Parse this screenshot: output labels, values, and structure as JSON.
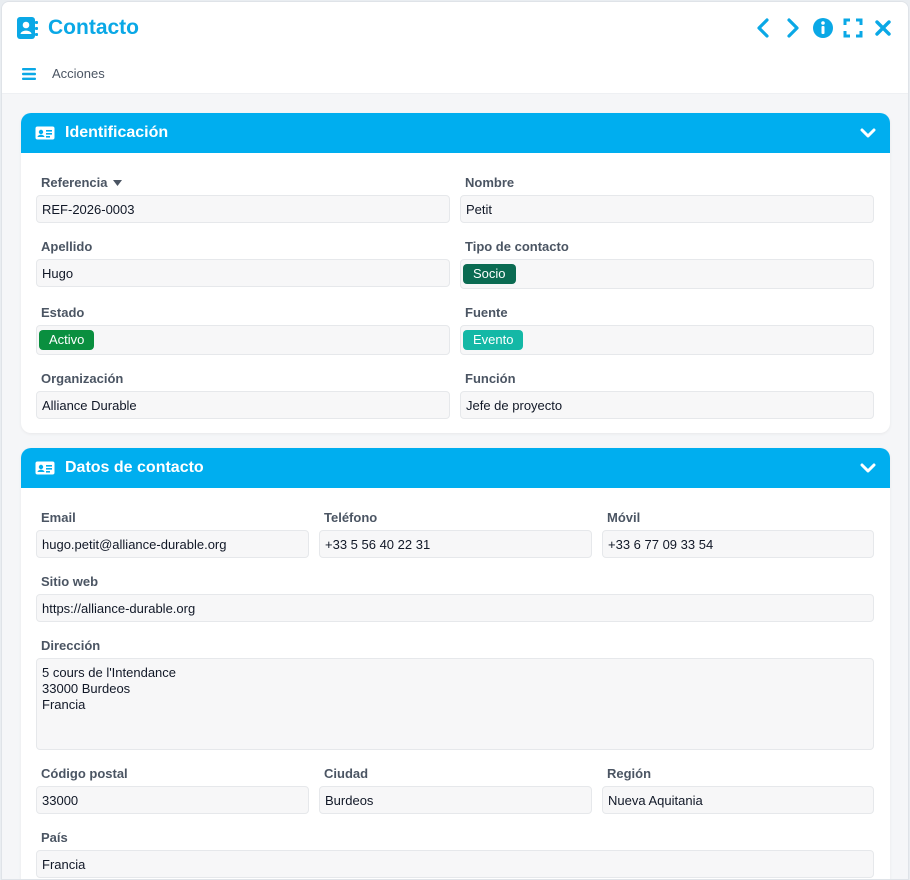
{
  "window": {
    "title": "Contacto",
    "accent": "#00aeef",
    "icons": [
      "contact-book-icon",
      "prev-icon",
      "next-icon",
      "info-icon",
      "fullscreen-icon",
      "close-icon"
    ]
  },
  "toolbar": {
    "actions_label": "Acciones"
  },
  "identificacion": {
    "title": "Identificación",
    "referencia": {
      "label": "Referencia",
      "value": "REF-2026-0003"
    },
    "nombre": {
      "label": "Nombre",
      "value": "Petit"
    },
    "apellido": {
      "label": "Apellido",
      "value": "Hugo"
    },
    "tipo_contacto": {
      "label": "Tipo de contacto",
      "value": "Socio",
      "color": "#0b6b52"
    },
    "estado": {
      "label": "Estado",
      "value": "Activo",
      "color": "#0a8f3f"
    },
    "fuente": {
      "label": "Fuente",
      "value": "Evento",
      "color": "#14b8a6"
    },
    "organizacion": {
      "label": "Organización",
      "value": "Alliance Durable"
    },
    "funcion": {
      "label": "Función",
      "value": "Jefe de proyecto"
    }
  },
  "datos_contacto": {
    "title": "Datos de contacto",
    "email": {
      "label": "Email",
      "value": "hugo.petit@alliance-durable.org"
    },
    "telefono": {
      "label": "Teléfono",
      "value": "+33 5 56 40 22 31"
    },
    "movil": {
      "label": "Móvil",
      "value": "+33 6 77 09 33 54"
    },
    "sitio_web": {
      "label": "Sitio web",
      "value": "https://alliance-durable.org"
    },
    "direccion": {
      "label": "Dirección",
      "value": "5 cours de l'Intendance\n33000 Burdeos\nFrancia"
    },
    "codigo_postal": {
      "label": "Código postal",
      "value": "33000"
    },
    "ciudad": {
      "label": "Ciudad",
      "value": "Burdeos"
    },
    "region": {
      "label": "Región",
      "value": "Nueva Aquitania"
    },
    "pais": {
      "label": "País",
      "value": "Francia"
    }
  }
}
